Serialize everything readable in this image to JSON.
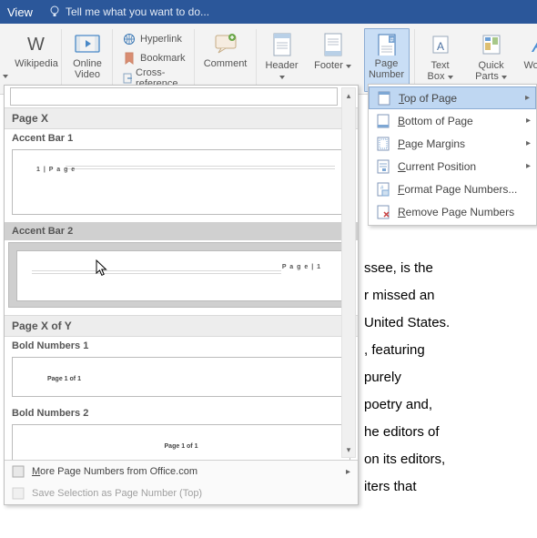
{
  "titlebar": {
    "view": "View",
    "tellme": "Tell me what you want to do..."
  },
  "ribbon": {
    "wikipedia": "Wikipedia",
    "onlineVideo": "Online\nVideo",
    "hyperlink": "Hyperlink",
    "bookmark": "Bookmark",
    "crossref": "Cross-reference",
    "comment": "Comment",
    "header": "Header",
    "footer": "Footer",
    "pageNumber": "Page\nNumber",
    "textBox": "Text\nBox",
    "quickParts": "Quick\nParts",
    "wordArt": "WordArt"
  },
  "dropdown": {
    "top": "Top of Page",
    "bottom": "Bottom of Page",
    "margins": "Page Margins",
    "current": "Current Position",
    "format": "Format Page Numbers...",
    "remove": "Remove Page Numbers"
  },
  "gallery": {
    "cat1": "Page X",
    "s1": "Accent Bar 1",
    "s1txt": "1 | P a g e",
    "s2": "Accent Bar 2",
    "s2txt": "P a g e  | 1",
    "cat2": "Page X of Y",
    "s3": "Bold Numbers 1",
    "s3txt": "Page 1 of 1",
    "s4": "Bold Numbers 2",
    "s4txt": "Page 1 of 1",
    "more": "More Page Numbers from Office.com",
    "save": "Save Selection as Page Number (Top)"
  },
  "doc": {
    "l1": "ssee, is the",
    "l2": "r missed an",
    "l3": "United States.",
    "l4": ", featuring",
    "l5": "purely",
    "l6": "poetry and,",
    "l7": "he editors of",
    "l8": "on its editors,",
    "l9": "iters that"
  }
}
